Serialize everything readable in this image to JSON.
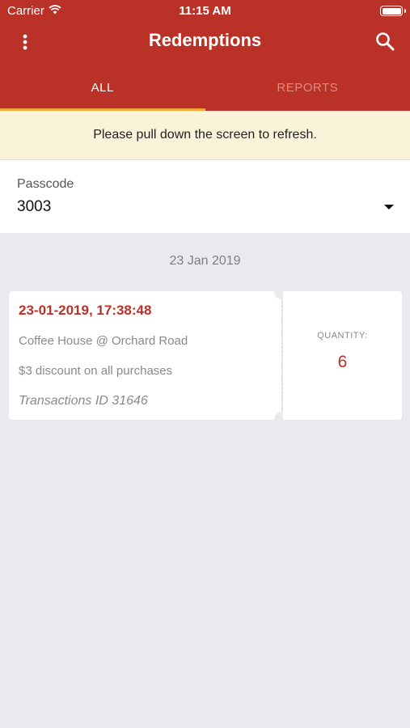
{
  "status_bar": {
    "carrier": "Carrier",
    "time": "11:15 AM"
  },
  "header": {
    "title": "Redemptions"
  },
  "tabs": [
    {
      "label": "ALL",
      "active": true
    },
    {
      "label": "REPORTS",
      "active": false
    }
  ],
  "banner": {
    "text": "Please pull down the screen to refresh."
  },
  "passcode": {
    "label": "Passcode",
    "value": "3003"
  },
  "sections": [
    {
      "date": "23 Jan 2019",
      "items": [
        {
          "datetime": "23-01-2019, 17:38:48",
          "outlet": "Coffee House @ Orchard Road",
          "offer": "$3 discount on all purchases",
          "transaction": "Transactions ID 31646",
          "quantity_label": "QUANTITY:",
          "quantity": "6"
        }
      ]
    }
  ],
  "colors": {
    "primary": "#b93127",
    "tab_indicator": "#f3a83a",
    "banner_bg": "#fbf3d9",
    "background": "#e9e9ee"
  },
  "icons": {
    "menu": "more-vert-icon",
    "search": "search-icon",
    "dropdown": "dropdown-arrow-icon",
    "wifi": "wifi-icon",
    "battery": "battery-icon"
  }
}
